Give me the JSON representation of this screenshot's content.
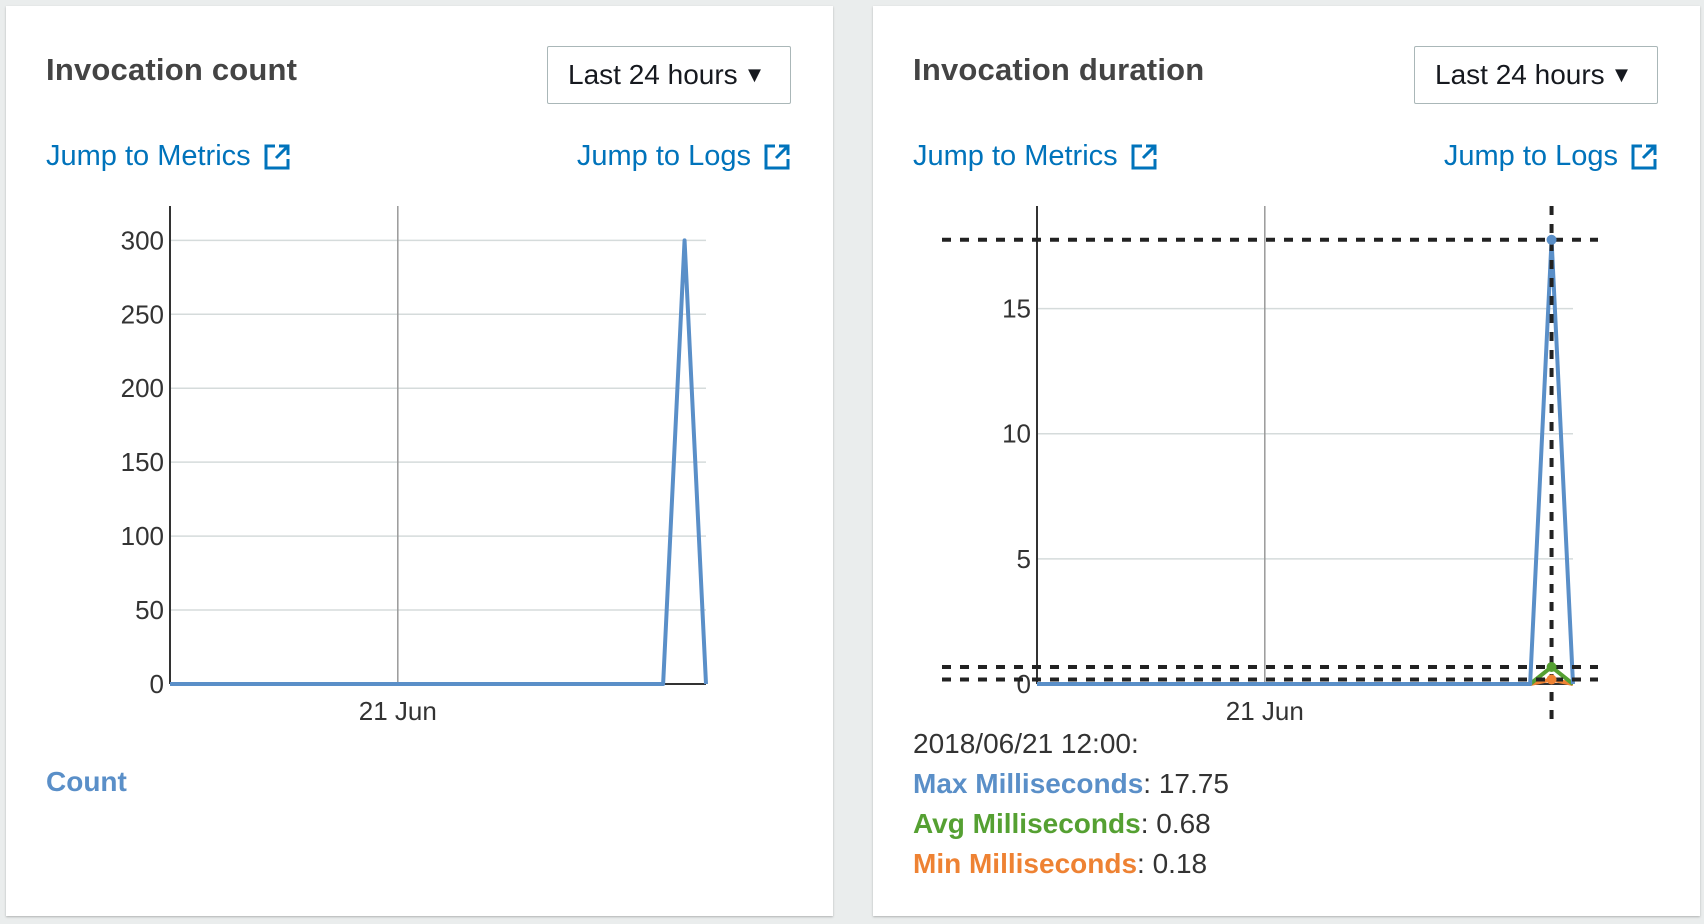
{
  "panels": {
    "count": {
      "title": "Invocation count",
      "range_label": "Last 24 hours",
      "metrics_link": "Jump to Metrics",
      "logs_link": "Jump to Logs",
      "legend": "Count"
    },
    "duration": {
      "title": "Invocation duration",
      "range_label": "Last 24 hours",
      "metrics_link": "Jump to Metrics",
      "logs_link": "Jump to Logs",
      "tooltip": {
        "timestamp": "2018/06/21 12:00:",
        "rows": [
          {
            "name": "Max Milliseconds",
            "value": ": 17.75"
          },
          {
            "name": "Avg Milliseconds",
            "value": ": 0.68"
          },
          {
            "name": "Min Milliseconds",
            "value": ": 0.18"
          }
        ]
      }
    }
  },
  "colors": {
    "link": "#0073bb",
    "max": "#5a8fc8",
    "avg": "#55a032",
    "min": "#ee8233",
    "grid": "#d5dbdb",
    "axis": "#333333"
  },
  "chart_data": [
    {
      "type": "line",
      "x_tick_labels": [
        "21 Jun"
      ],
      "ylim": [
        0,
        330
      ],
      "y_ticks": [
        0,
        50,
        100,
        150,
        200,
        250,
        300
      ],
      "grid": true,
      "legend": "bottom-left",
      "series": [
        {
          "name": "Count",
          "color": "#5a8fc8",
          "x": [
            0,
            0.2,
            0.4,
            0.6,
            0.8,
            0.92,
            0.96,
            1.0
          ],
          "values": [
            0,
            0,
            0,
            0,
            0,
            0,
            300,
            0
          ]
        }
      ]
    },
    {
      "type": "line",
      "x_tick_labels": [
        "21 Jun"
      ],
      "ylim": [
        0,
        19.5
      ],
      "y_ticks": [
        0,
        5,
        10,
        15
      ],
      "grid": true,
      "crosshair": {
        "x": 0.96,
        "y_values": [
          17.75,
          0.68,
          0.18
        ]
      },
      "series": [
        {
          "name": "Max Milliseconds",
          "color": "#5a8fc8",
          "x": [
            0,
            0.2,
            0.4,
            0.6,
            0.8,
            0.92,
            0.96,
            1.0
          ],
          "values": [
            0,
            0,
            0,
            0,
            0,
            0,
            17.75,
            0
          ]
        },
        {
          "name": "Avg Milliseconds",
          "color": "#55a032",
          "x": [
            0,
            0.2,
            0.4,
            0.6,
            0.8,
            0.92,
            0.96,
            1.0
          ],
          "values": [
            0,
            0,
            0,
            0,
            0,
            0,
            0.68,
            0
          ]
        },
        {
          "name": "Min Milliseconds",
          "color": "#ee8233",
          "x": [
            0,
            0.2,
            0.4,
            0.6,
            0.8,
            0.92,
            0.96,
            1.0
          ],
          "values": [
            0,
            0,
            0,
            0,
            0,
            0,
            0.18,
            0
          ]
        }
      ]
    }
  ]
}
